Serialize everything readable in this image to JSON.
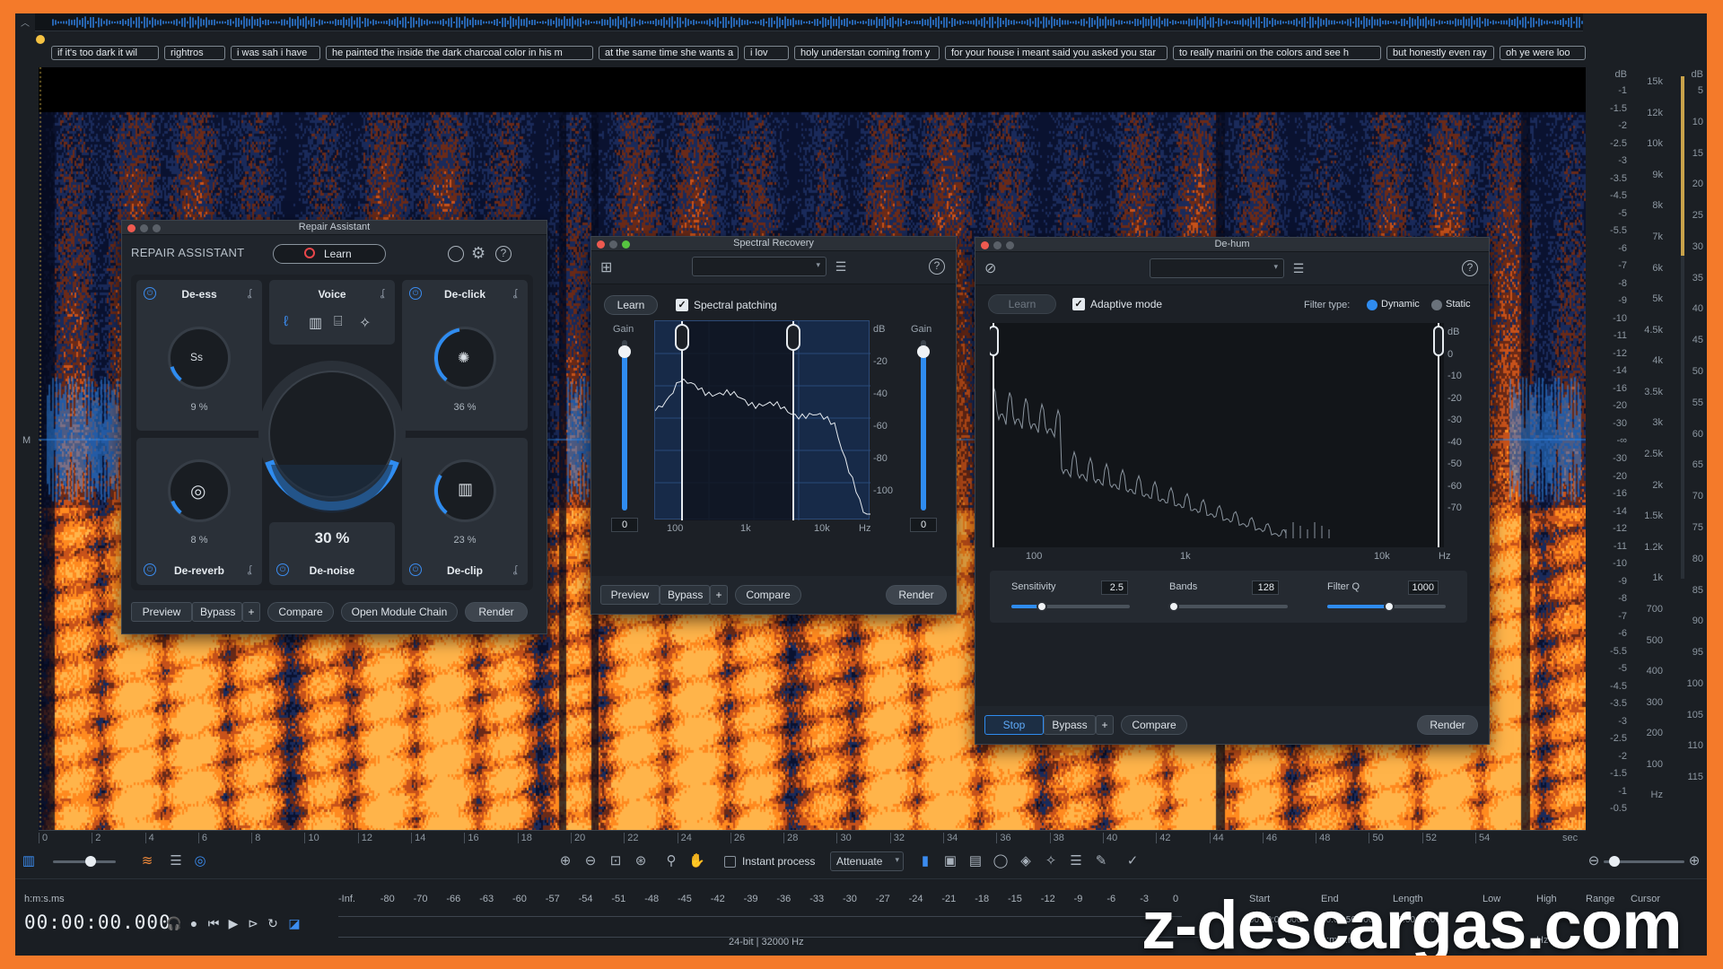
{
  "overview": {},
  "transcript": [
    "if it's too dark it wil",
    "rightros",
    "i was sah i have",
    "he painted the inside the dark charcoal color in his m",
    "at the same time she wants a",
    "i lov",
    "holy understan coming from y",
    "for your house i meant said you asked you star",
    "to really marini on the colors and see h",
    "but honestly even ray",
    "oh ye were loo"
  ],
  "spectrogram": {
    "channel_label": "M"
  },
  "time_ruler": {
    "ticks": [
      "0",
      "2",
      "4",
      "6",
      "8",
      "10",
      "12",
      "14",
      "16",
      "18",
      "20",
      "22",
      "24",
      "26",
      "28",
      "30",
      "32",
      "34",
      "36",
      "38",
      "40",
      "42",
      "44",
      "46",
      "48",
      "50",
      "52",
      "54"
    ],
    "unit": "sec"
  },
  "db_scale": {
    "header": "dB",
    "ticks": [
      "-1",
      "-1.5",
      "-2",
      "-2.5",
      "-3",
      "-3.5",
      "-4.5",
      "-5",
      "-5.5",
      "-6",
      "-7",
      "-8",
      "-9",
      "-10",
      "-11",
      "-12",
      "-14",
      "-16",
      "-20",
      "-30",
      "-∞",
      "-30",
      "-20",
      "-16",
      "-14",
      "-12",
      "-11",
      "-10",
      "-9",
      "-8",
      "-7",
      "-6",
      "-5.5",
      "-5",
      "-4.5",
      "-3.5",
      "-3",
      "-2.5",
      "-2",
      "-1.5",
      "-1",
      "-0.5"
    ]
  },
  "freq_scale": {
    "ticks": [
      "15k",
      "12k",
      "10k",
      "9k",
      "8k",
      "7k",
      "6k",
      "5k",
      "4.5k",
      "4k",
      "3.5k",
      "3k",
      "2.5k",
      "2k",
      "1.5k",
      "1.2k",
      "1k",
      "700",
      "500",
      "400",
      "300",
      "200",
      "100",
      "Hz"
    ]
  },
  "meter_scale": {
    "header": "dB",
    "ticks": [
      "5",
      "10",
      "15",
      "20",
      "25",
      "30",
      "35",
      "40",
      "45",
      "50",
      "55",
      "60",
      "65",
      "70",
      "75",
      "80",
      "85",
      "90",
      "95",
      "100",
      "105",
      "110",
      "115"
    ]
  },
  "toolbar": {
    "instant_process": "Instant process",
    "attenuate": "Attenuate"
  },
  "transport": {
    "time_format": "h:m:s.ms",
    "time": "00:00:00.000",
    "level_ticks": [
      "-Inf.",
      "-80",
      "-70",
      "-66",
      "-63",
      "-60",
      "-57",
      "-54",
      "-51",
      "-48",
      "-45",
      "-42",
      "-39",
      "-36",
      "-33",
      "-30",
      "-27",
      "-24",
      "-21",
      "-18",
      "-15",
      "-12",
      "-9",
      "-6",
      "-3",
      "0"
    ],
    "format": "24-bit | 32000 Hz",
    "sel_headers": [
      "Start",
      "End",
      "Length",
      "Low",
      "High",
      "Range",
      "Cursor"
    ],
    "sel_values": {
      "start": "00:00:00.000",
      "end": "00:00:56.000",
      "length": "00:00:56.000",
      "unit": "h:m:s.ms",
      "hz": "Hz"
    },
    "watermark": "z-descargas.com"
  },
  "repair": {
    "window_title": "Repair Assistant",
    "header": "REPAIR ASSISTANT",
    "learn": "Learn",
    "modules": {
      "deess": {
        "label": "De-ess",
        "pct": "9 %",
        "value": 9
      },
      "voice": {
        "label": "Voice"
      },
      "declick": {
        "label": "De-click",
        "pct": "36 %",
        "value": 36
      },
      "dereverb": {
        "label": "De-reverb",
        "pct": "8 %",
        "value": 8
      },
      "denoise": {
        "label": "De-noise",
        "pct": "30 %",
        "value": 30
      },
      "declip": {
        "label": "De-clip",
        "pct": "23 %",
        "value": 23
      }
    },
    "buttons": {
      "preview": "Preview",
      "bypass": "Bypass",
      "plus": "+",
      "compare": "Compare",
      "chain": "Open Module Chain",
      "render": "Render"
    }
  },
  "specrec": {
    "window_title": "Spectral Recovery",
    "learn": "Learn",
    "patching": "Spectral patching",
    "gain_label": "Gain",
    "gain_left": "0",
    "gain_right": "0",
    "db_ticks": [
      "dB",
      "-20",
      "-40",
      "-60",
      "-80",
      "-100"
    ],
    "freq_ticks": [
      "100",
      "1k",
      "10k",
      "Hz"
    ],
    "buttons": {
      "preview": "Preview",
      "bypass": "Bypass",
      "plus": "+",
      "compare": "Compare",
      "render": "Render"
    }
  },
  "dehum": {
    "window_title": "De-hum",
    "learn": "Learn",
    "adaptive": "Adaptive mode",
    "filter_type": "Filter type:",
    "dynamic": "Dynamic",
    "static": "Static",
    "db_ticks": [
      "dB",
      "0",
      "-10",
      "-20",
      "-30",
      "-40",
      "-50",
      "-60",
      "-70"
    ],
    "freq_ticks": [
      "100",
      "1k",
      "10k",
      "Hz"
    ],
    "sensitivity": {
      "label": "Sensitivity",
      "value": "2.5",
      "fraction": 0.26
    },
    "bands": {
      "label": "Bands",
      "value": "128",
      "fraction": 0.04
    },
    "filterq": {
      "label": "Filter Q",
      "value": "1000",
      "fraction": 0.52
    },
    "buttons": {
      "stop": "Stop",
      "bypass": "Bypass",
      "plus": "+",
      "compare": "Compare",
      "render": "Render"
    }
  },
  "colors": {
    "accent": "#2f8cf0",
    "spectro_hot": "#ff8a1f",
    "frame": "#f47a2a"
  }
}
